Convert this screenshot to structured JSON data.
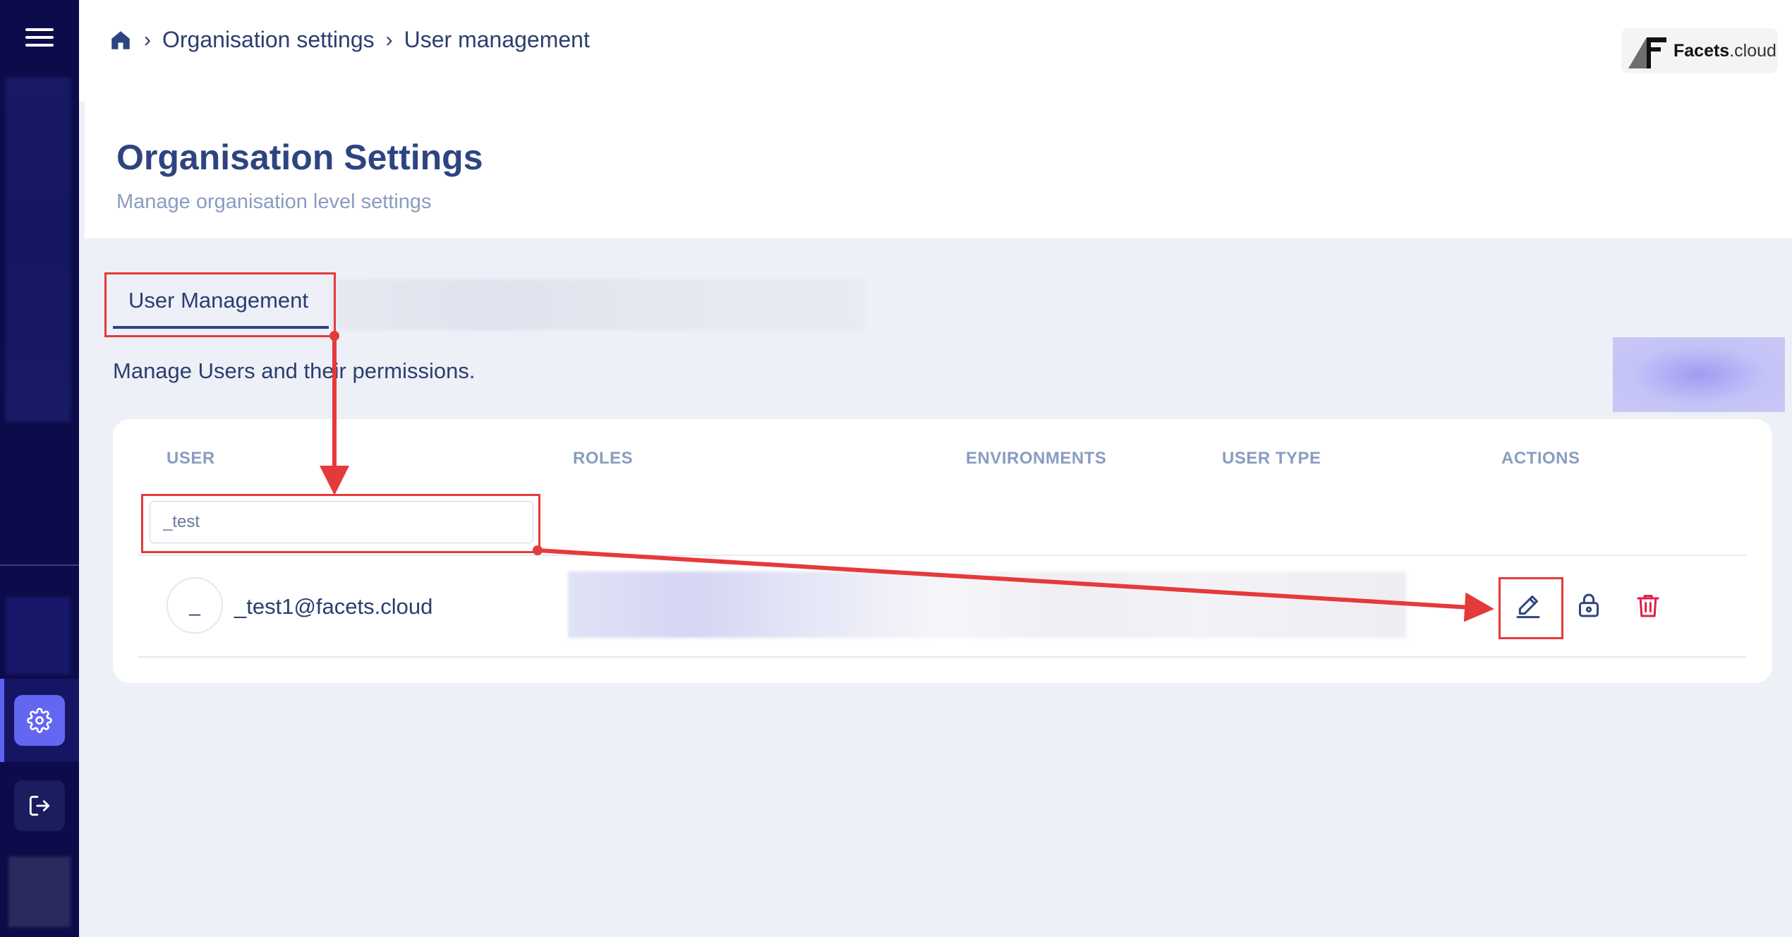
{
  "breadcrumb": {
    "items": [
      "Organisation settings",
      "User management"
    ]
  },
  "brand": {
    "name_bold": "Facets",
    "name_light": ".cloud"
  },
  "header": {
    "title": "Organisation Settings",
    "subtitle": "Manage organisation level settings"
  },
  "tabs": {
    "active_label": "User Management"
  },
  "section": {
    "description": "Manage Users and their permissions."
  },
  "table": {
    "columns": [
      "USER",
      "ROLES",
      "ENVIRONMENTS",
      "USER TYPE",
      "ACTIONS"
    ],
    "filter": {
      "value": "_test"
    },
    "rows": [
      {
        "avatar_initial": "_",
        "email": "_test1@facets.cloud"
      }
    ]
  },
  "icons": {
    "sidebar_menu": "hamburger-icon",
    "settings": "gear-icon",
    "logout": "logout-icon",
    "home": "home-icon",
    "edit": "pencil-icon",
    "lock": "lock-icon",
    "delete": "trash-icon"
  },
  "colors": {
    "sidebar_bg": "#0d0c4a",
    "accent": "#6366f1",
    "title": "#2e4482",
    "delete": "#e11d48",
    "annotation": "#e53a3a"
  }
}
